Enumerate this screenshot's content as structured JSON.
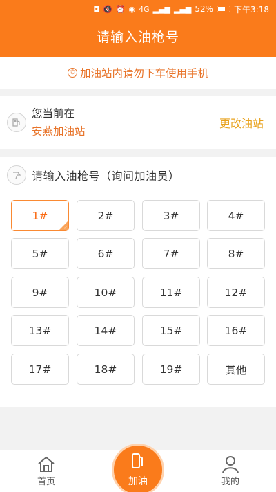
{
  "status_bar": {
    "network": "4G",
    "battery": "52%",
    "time": "下午3:18"
  },
  "header": {
    "title": "请输入油枪号"
  },
  "notice": {
    "text": "加油站内请勿下车使用手机"
  },
  "station": {
    "label": "您当前在",
    "name": "安燕加油站",
    "change_label": "更改油站"
  },
  "nozzle_panel": {
    "title": "请输入油枪号（询问加油员）",
    "selected": "1#",
    "nozzles": [
      "1#",
      "2#",
      "3#",
      "4#",
      "5#",
      "6#",
      "7#",
      "8#",
      "9#",
      "10#",
      "11#",
      "12#",
      "13#",
      "14#",
      "15#",
      "16#",
      "17#",
      "18#",
      "19#",
      "其他"
    ]
  },
  "bottom_nav": {
    "home": "首页",
    "refuel": "加油",
    "me": "我的"
  },
  "colors": {
    "brand": "#fa7b1b",
    "accent_text": "#e8742a",
    "change_link": "#e8a21d"
  }
}
